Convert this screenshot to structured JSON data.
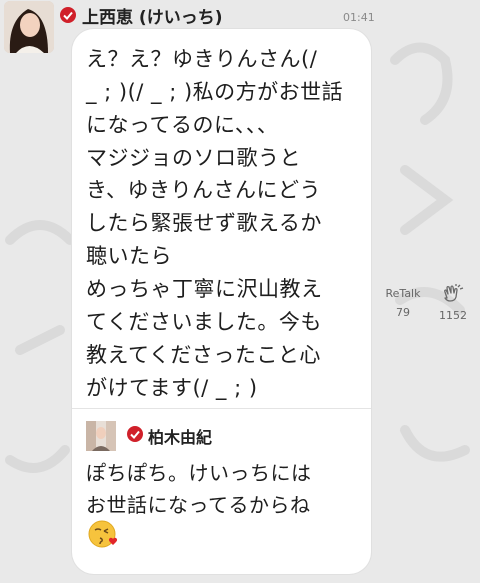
{
  "post": {
    "author": "上西恵 (けいっち)",
    "time": "01:41",
    "message_lines": [
      "え？え？ゆきりんさん(/",
      "_ ; )(/ _ ; )私の方がお世話",
      "になってるのに、、、",
      "マジジョのソロ歌うと",
      "き、ゆきりんさんにどう",
      "したら緊張せず歌えるか",
      "聴いたら",
      "めっちゃ丁寧に沢山教え",
      "てくださいました。今も",
      "教えてくださったこと心",
      "がけてます(/ _ ; )"
    ]
  },
  "quote": {
    "author": "柏木由紀",
    "message_lines": [
      "ぽちぽち。けいっちには",
      "お世話になってるからね"
    ],
    "emoji": "kissing-face-with-heart"
  },
  "actions": {
    "retalk": {
      "label": "ReTalk",
      "count": "79",
      "icon": "retalk-icon"
    },
    "clap": {
      "count": "1152",
      "icon": "clap-icon"
    }
  },
  "colors": {
    "background": "#e9e9e9",
    "bubble": "#ffffff",
    "verified": "#d0202a",
    "text": "#1e1e1e"
  }
}
